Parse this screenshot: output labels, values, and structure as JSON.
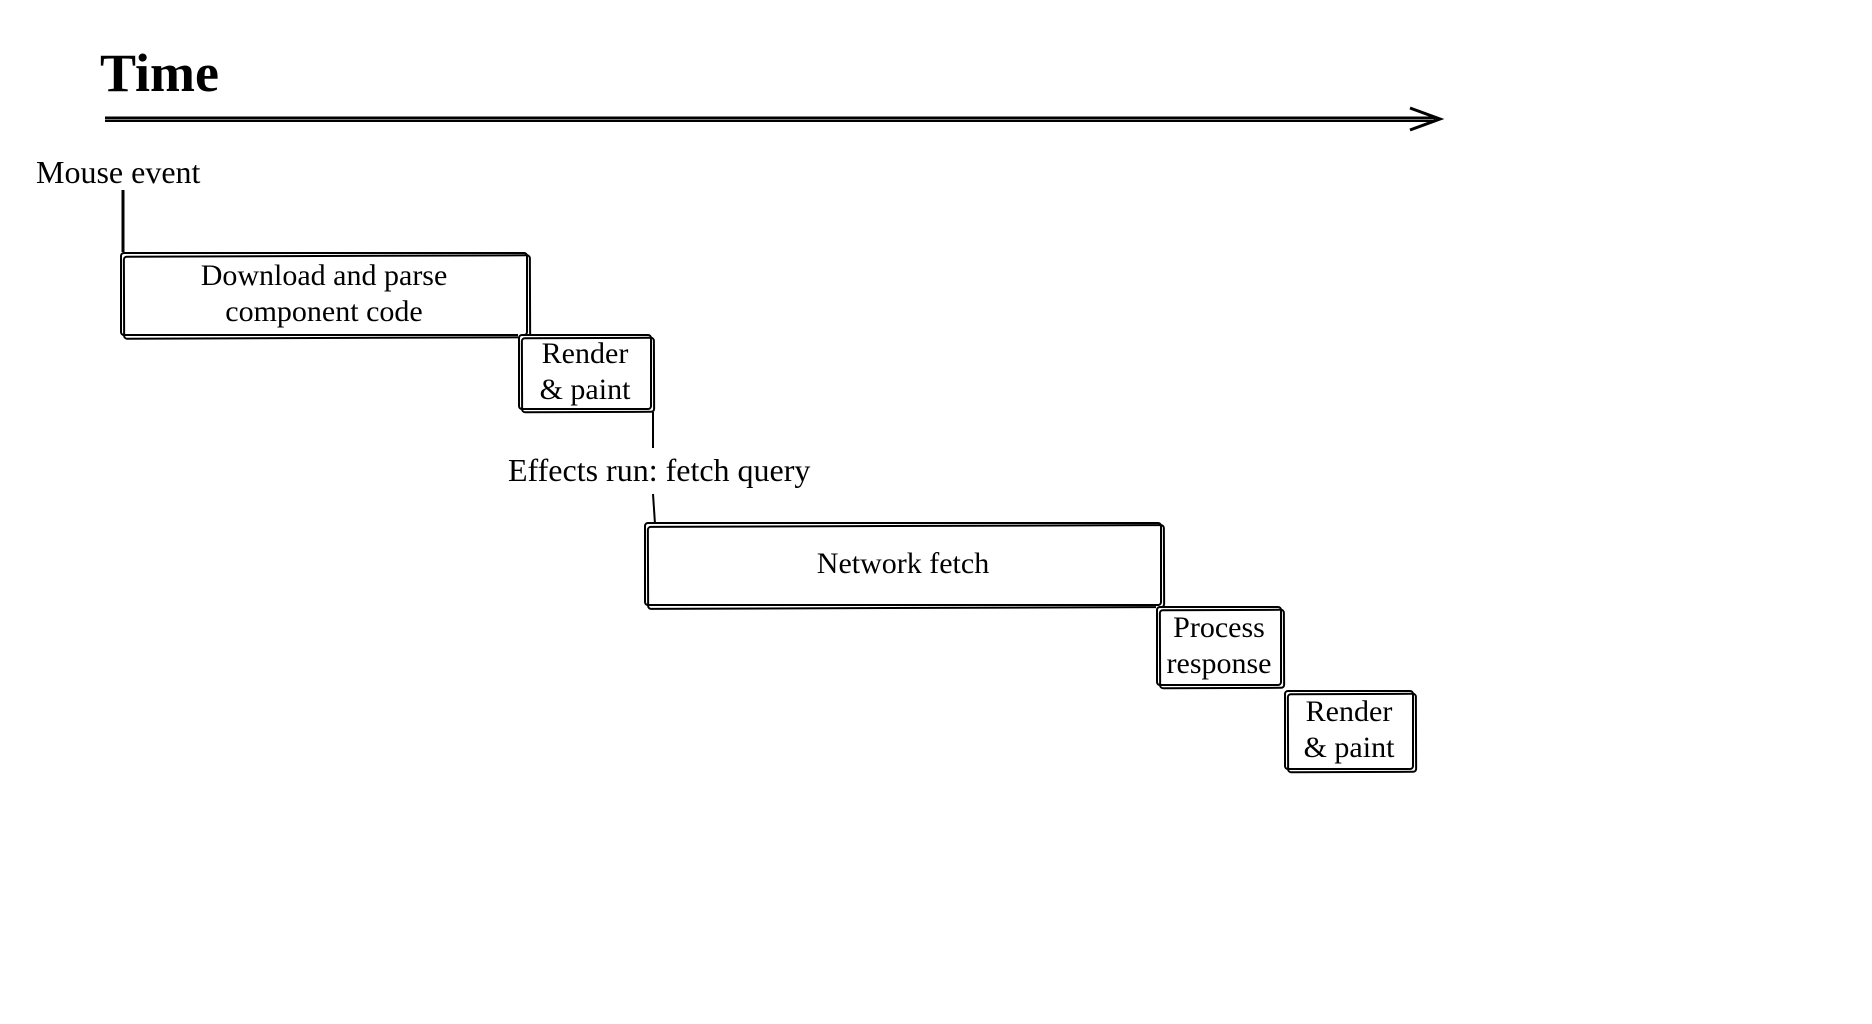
{
  "title": "Time",
  "labels": {
    "mouse_event": "Mouse event",
    "effects_run": "Effects run: fetch query"
  },
  "boxes": {
    "download_parse": "Download and parse\ncomponent code",
    "render_paint_1": "Render\n& paint",
    "network_fetch": "Network fetch",
    "process_response": "Process\nresponse",
    "render_paint_2": "Render\n& paint"
  }
}
